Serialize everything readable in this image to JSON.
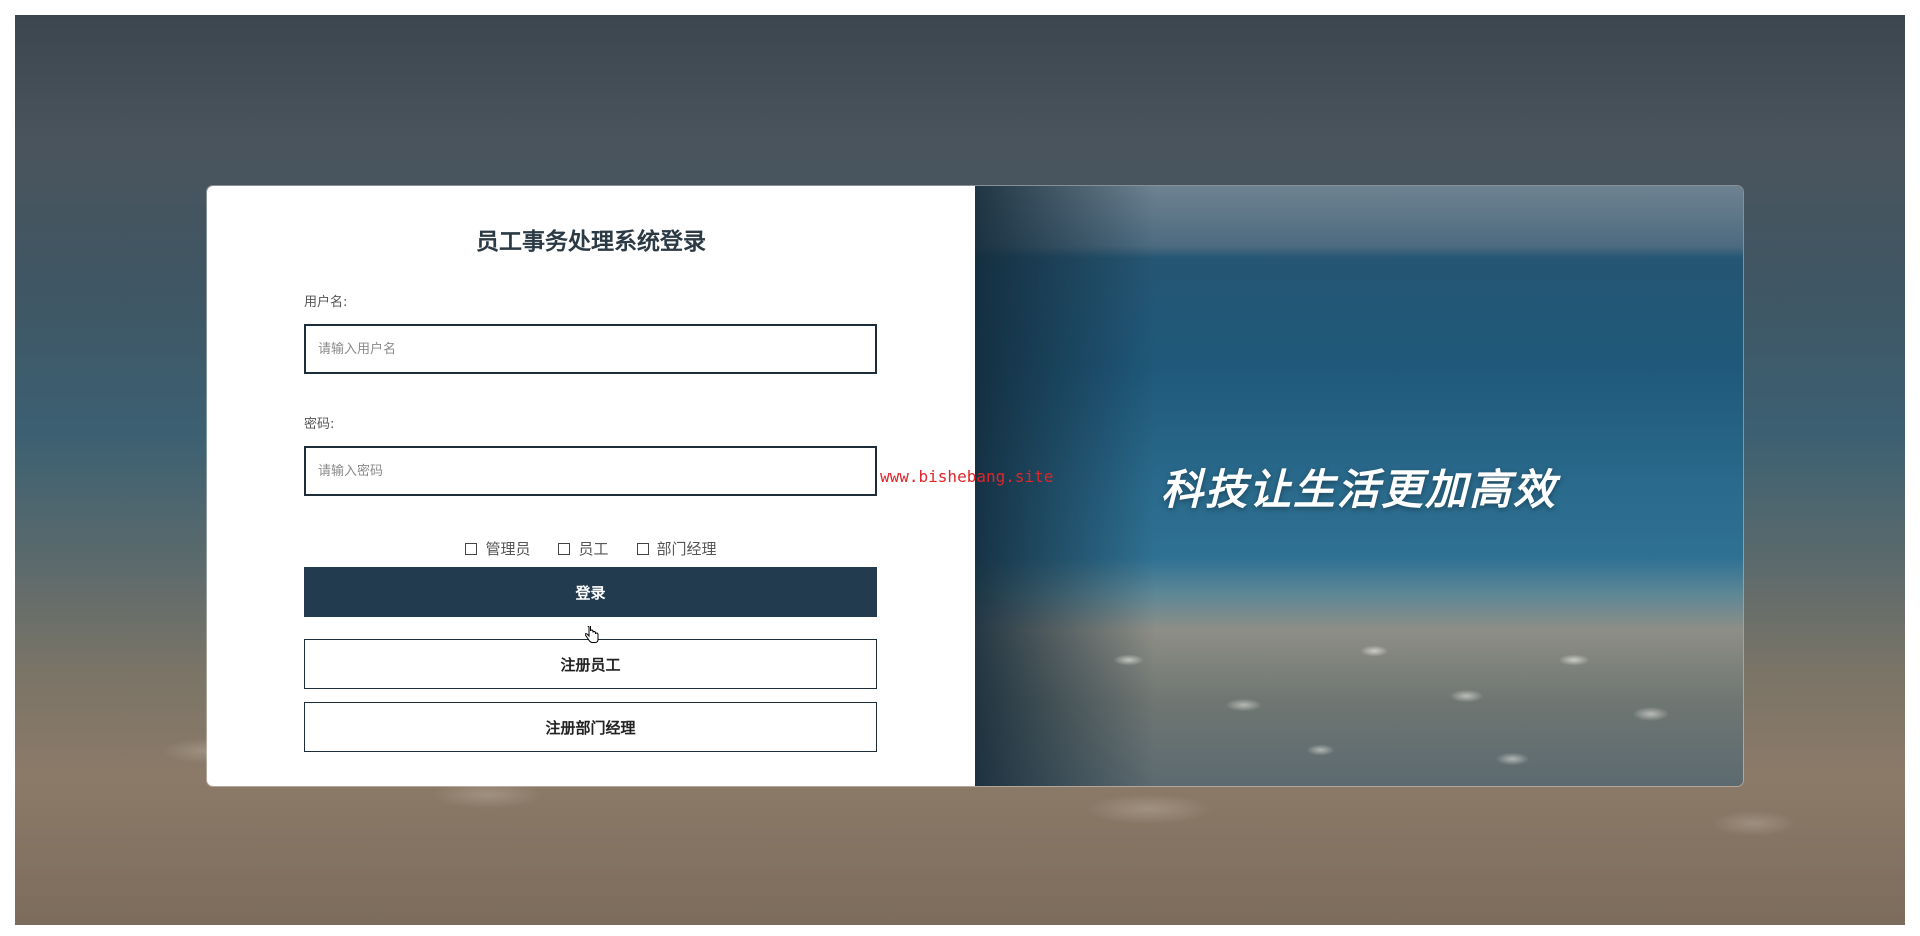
{
  "login": {
    "title": "员工事务处理系统登录",
    "username_label": "用户名:",
    "username_placeholder": "请输入用户名",
    "password_label": "密码:",
    "password_placeholder": "请输入密码",
    "roles": [
      "管理员",
      "员工",
      "部门经理"
    ],
    "login_button": "登录",
    "register_employee_button": "注册员工",
    "register_manager_button": "注册部门经理"
  },
  "banner": {
    "slogan": "科技让生活更加高效"
  },
  "watermark": "www.bishebang.site",
  "colors": {
    "primary": "#233b4f",
    "watermark": "#e0262a"
  }
}
